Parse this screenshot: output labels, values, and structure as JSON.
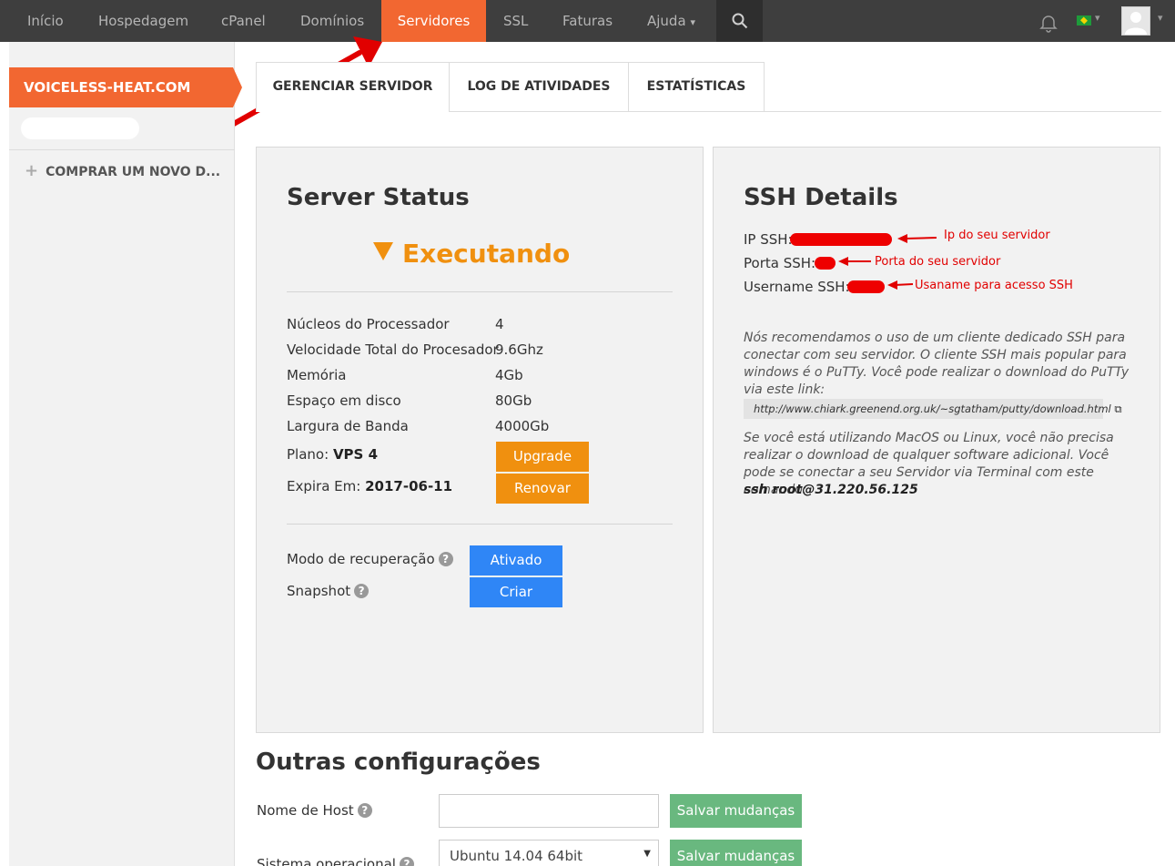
{
  "nav": {
    "items": [
      {
        "label": "Início"
      },
      {
        "label": "Hospedagem"
      },
      {
        "label": "cPanel"
      },
      {
        "label": "Domínios"
      },
      {
        "label": "Servidores",
        "active": true
      },
      {
        "label": "SSL"
      },
      {
        "label": "Faturas"
      },
      {
        "label": "Ajuda"
      }
    ],
    "help_chevron": "⌄",
    "active_color": "#f26731"
  },
  "sidebar": {
    "domain": "VOICELESS-HEAT.COM",
    "buy_label": "COMPRAR UM NOVO D...",
    "plus": "+"
  },
  "tabs": [
    {
      "label": "GERENCIAR SERVIDOR",
      "active": true
    },
    {
      "label": "LOG DE ATIVIDADES"
    },
    {
      "label": "ESTATÍSTICAS"
    }
  ],
  "server_status": {
    "title": "Server Status",
    "status": "Executando",
    "specs": [
      {
        "label": "Núcleos do Processador",
        "value": "4"
      },
      {
        "label": "Velocidade Total do Procesador",
        "value": "9.6Ghz"
      },
      {
        "label": "Memória",
        "value": "4Gb"
      },
      {
        "label": "Espaço em disco",
        "value": "80Gb"
      },
      {
        "label": "Largura de Banda",
        "value": "4000Gb"
      }
    ],
    "plan_label": "Plano:",
    "plan_value": "VPS 4",
    "upgrade_label": "Upgrade",
    "expires_label": "Expira Em:",
    "expires_value": "2017-06-11",
    "renew_label": "Renovar",
    "recovery_label": "Modo de recuperação",
    "recovery_button": "Ativado",
    "snapshot_label": "Snapshot",
    "snapshot_button": "Criar",
    "help_glyph": "?"
  },
  "ssh": {
    "title": "SSH Details",
    "ip_label": "IP SSH:",
    "port_label": "Porta SSH:",
    "user_label": "Username SSH:",
    "ip_note": "Ip do seu servidor",
    "port_note": "Porta do seu servidor",
    "user_note": "Usaname para acesso SSH",
    "recommend_text": "Nós recomendamos o uso de um cliente dedicado SSH para conectar com seu servidor. O cliente SSH mais popular para windows é o PuTTy. Você pode realizar o download do PuTTy via este link:",
    "putty_link": "http://www.chiark.greenend.org.uk/~sgtatham/putty/download.html",
    "external_glyph": "⧉",
    "mac_text": "Se você está utilizando MacOS ou Linux, você não precisa realizar o download de qualquer software adicional. Você pode se conectar a seu Servidor via Terminal com este comando:",
    "command": "ssh root@31.220.56.125"
  },
  "other": {
    "title": "Outras configurações",
    "hostname_label": "Nome de Host",
    "hostname_value": "",
    "save_label": "Salvar mudanças",
    "os_label": "Sistema operacional",
    "os_value": "Ubuntu 14.04 64bit",
    "os_caret": "▼"
  }
}
